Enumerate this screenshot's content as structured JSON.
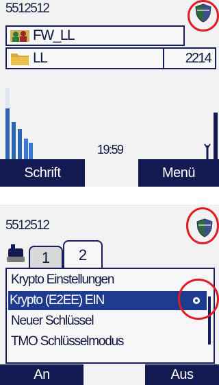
{
  "screen1": {
    "device_id": "5512512",
    "group_label": "FW_LL",
    "folder_label": "LL",
    "folder_number": "2214",
    "time": "19:59",
    "softkey_left": "Schrift",
    "softkey_right": "Menü",
    "group_icon": "group-talk-icon",
    "folder_icon": "folder-icon",
    "status_icon": "shield-icon"
  },
  "screen2": {
    "device_id": "5512512",
    "tabs": [
      "1",
      "2"
    ],
    "active_tab": "2",
    "menu_items": [
      "Krypto Einstellungen",
      "Krypto (E2EE) EIN",
      "Neuer Schlüssel",
      "TMO Schlüsselmodus"
    ],
    "selected_index": 1,
    "softkey_left": "An",
    "softkey_right": "Aus",
    "status_icon": "shield-icon",
    "tab_icon": "radio-device-icon"
  },
  "colors": {
    "softkey_bg": "#141b52",
    "selection_bg": "#1d3c8f",
    "highlight_circle": "#e01b24",
    "screen_bg": "#f2f2f2"
  }
}
